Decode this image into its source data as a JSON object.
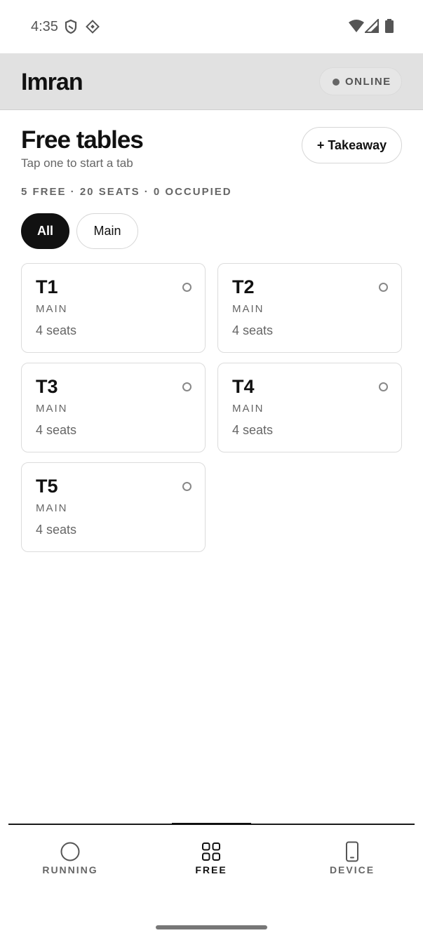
{
  "status_bar": {
    "time": "4:35",
    "left_icons": [
      "shield-icon",
      "diamond-icon"
    ],
    "right_icons": [
      "wifi-icon",
      "signal-icon",
      "battery-icon"
    ]
  },
  "header": {
    "title": "Imran",
    "status_label": "ONLINE"
  },
  "section": {
    "title": "Free tables",
    "subtitle": "Tap one to start a tab",
    "takeaway_label": "+ Takeaway",
    "summary": "5 FREE · 20 SEATS · 0 OCCUPIED"
  },
  "filters": [
    {
      "label": "All",
      "selected": true
    },
    {
      "label": "Main",
      "selected": false
    }
  ],
  "tables": [
    {
      "name": "T1",
      "area": "MAIN",
      "seats": "4 seats"
    },
    {
      "name": "T2",
      "area": "MAIN",
      "seats": "4 seats"
    },
    {
      "name": "T3",
      "area": "MAIN",
      "seats": "4 seats"
    },
    {
      "name": "T4",
      "area": "MAIN",
      "seats": "4 seats"
    },
    {
      "name": "T5",
      "area": "MAIN",
      "seats": "4 seats"
    }
  ],
  "bottom_nav": [
    {
      "label": "RUNNING",
      "icon": "circle-icon",
      "active": false
    },
    {
      "label": "FREE",
      "icon": "grid-icon",
      "active": true
    },
    {
      "label": "DEVICE",
      "icon": "phone-icon",
      "active": false
    }
  ],
  "colors": {
    "accent": "#111111",
    "header_bg": "#e1e1e1",
    "muted_text": "#666666",
    "card_border": "#dcdcdc"
  }
}
